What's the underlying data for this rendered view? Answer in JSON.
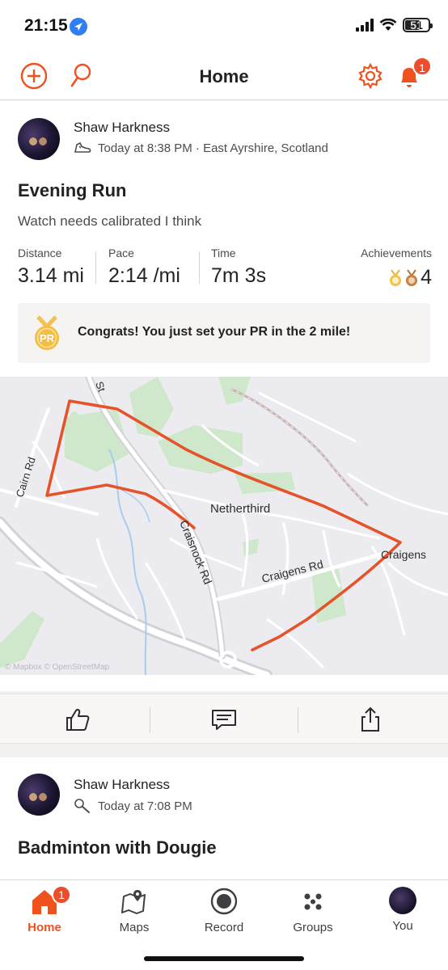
{
  "status_bar": {
    "time": "21:15",
    "battery": "51"
  },
  "nav": {
    "title": "Home",
    "notification_count": "1"
  },
  "activities": [
    {
      "athlete": "Shaw Harkness",
      "meta": "Today at 8:38 PM · East Ayrshire, Scotland",
      "title": "Evening Run",
      "description": "Watch needs calibrated I think",
      "stats": {
        "distance": {
          "label": "Distance",
          "value": "3.14 mi"
        },
        "pace": {
          "label": "Pace",
          "value": "2:14 /mi"
        },
        "time": {
          "label": "Time",
          "value": "7m 3s"
        },
        "achievements": {
          "label": "Achievements",
          "value": "4"
        }
      },
      "pr_badge": "PR",
      "pr_message": "Congrats! You just set your PR in the 2 mile!",
      "map": {
        "labels": {
          "netherthird": "Netherthird",
          "craigens": "Craigens",
          "craigens_rd": "Craigens Rd",
          "craisnock_rd": "Craisnock Rd",
          "cairn_rd": "Cairn Rd",
          "st": "St"
        },
        "credit": "© Mapbox © OpenStreetMap",
        "route_color": "#e5532a"
      }
    },
    {
      "athlete": "Shaw Harkness",
      "meta": "Today at 7:08 PM",
      "title": "Badminton with Dougie"
    }
  ],
  "tabs": [
    {
      "label": "Home",
      "active": true,
      "badge": "1"
    },
    {
      "label": "Maps"
    },
    {
      "label": "Record"
    },
    {
      "label": "Groups"
    },
    {
      "label": "You"
    }
  ],
  "colors": {
    "accent": "#f0521e",
    "badge": "#ec4d2b",
    "route": "#e5532a"
  }
}
